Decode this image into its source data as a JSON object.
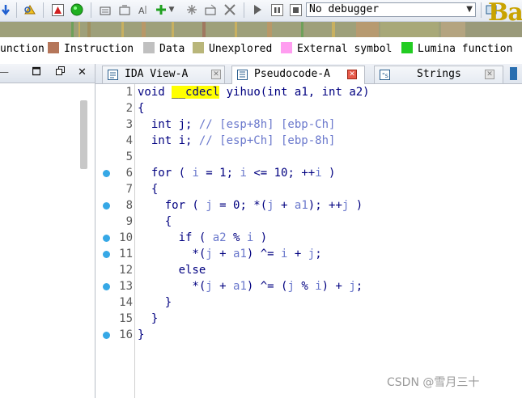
{
  "toolbar": {
    "debugger_select": "No debugger",
    "brand_text": "Ba"
  },
  "legend": {
    "items": [
      {
        "label": "unction",
        "color": ""
      },
      {
        "label": "Instruction",
        "color": "#b5765a"
      },
      {
        "label": "Data",
        "color": "#c0c0c0"
      },
      {
        "label": "Unexplored",
        "color": "#b9b67a"
      },
      {
        "label": "External symbol",
        "color": "#ff9df0"
      },
      {
        "label": "Lumina function",
        "color": "#22cc22"
      }
    ]
  },
  "tabs": [
    {
      "label": "IDA View-A",
      "active": false
    },
    {
      "label": "Pseudocode-A",
      "active": true
    },
    {
      "label": "Strings",
      "active": false
    }
  ],
  "code": {
    "line_numbers": [
      "1",
      "2",
      "3",
      "4",
      "5",
      "6",
      "7",
      "8",
      "9",
      "10",
      "11",
      "12",
      "13",
      "14",
      "15",
      "16"
    ],
    "breakpoint_lines": [
      "6",
      "8",
      "10",
      "11",
      "13",
      "16"
    ],
    "lines": {
      "l1_void": "void ",
      "l1_cdecl": "__cdecl",
      "l1_rest": " yihuo(int a1, int a2)",
      "l2": "{",
      "l3_decl": "  int j; ",
      "l3_cm": "// [esp+8h] [ebp-Ch]",
      "l4_decl": "  int i; ",
      "l4_cm": "// [esp+Ch] [ebp-8h]",
      "l5": "",
      "l6": "  for ( i = 1; i <= 10; ++i )",
      "l7": "  {",
      "l8": "    for ( j = 0; *(j + a1); ++j )",
      "l9": "    {",
      "l10": "      if ( a2 % i )",
      "l11": "        *(j + a1) ^= i + j;",
      "l12": "      else",
      "l13": "        *(j + a1) ^= (j % i) + j;",
      "l14": "    }",
      "l15": "  }",
      "l16": "}"
    }
  },
  "watermark": "CSDN @雪月三十"
}
